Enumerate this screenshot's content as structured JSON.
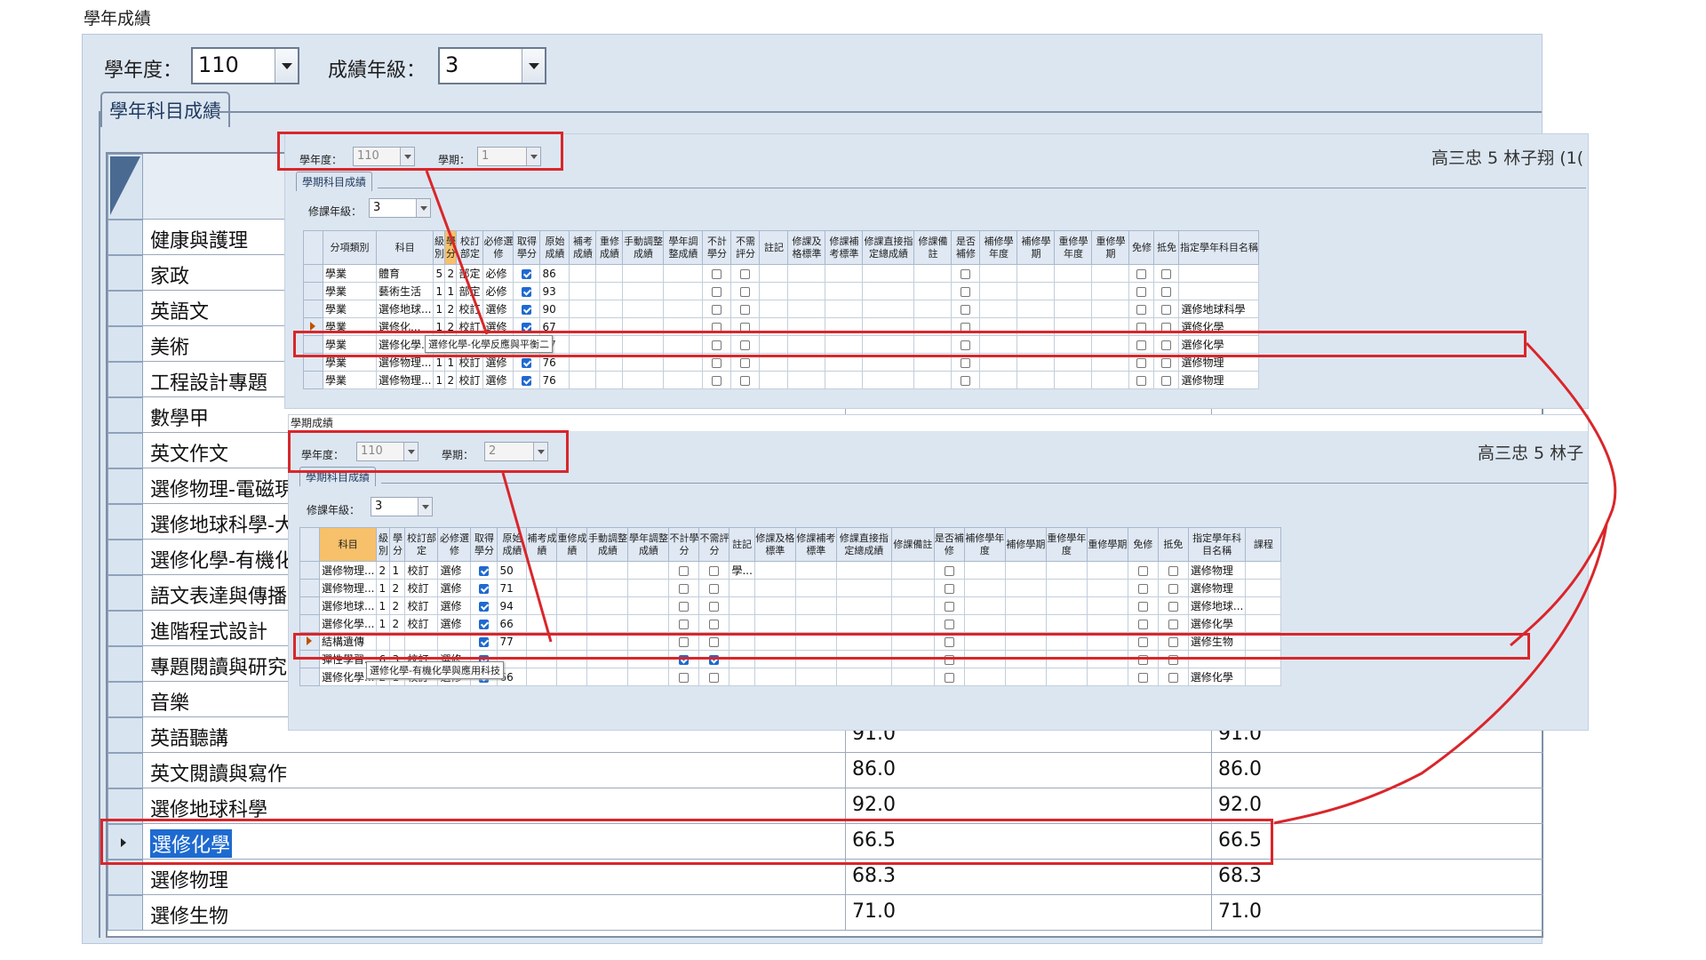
{
  "window_title": "學年成績",
  "filters": {
    "year_label": "學年度：",
    "year_value": "110",
    "grade_label": "成績年級：",
    "grade_value": "3"
  },
  "tab_label": "學年科目成績",
  "big_grid": {
    "rows": [
      {
        "subject": "健康與護理",
        "score1": "",
        "score2": ""
      },
      {
        "subject": "家政",
        "score1": "",
        "score2": ""
      },
      {
        "subject": "英語文",
        "score1": "",
        "score2": ""
      },
      {
        "subject": "美術",
        "score1": "",
        "score2": ""
      },
      {
        "subject": "工程設計專題",
        "score1": "",
        "score2": ""
      },
      {
        "subject": "數學甲",
        "score1": "",
        "score2": ""
      },
      {
        "subject": "英文作文",
        "score1": "",
        "score2": ""
      },
      {
        "subject": "選修物理-電磁現",
        "score1": "",
        "score2": ""
      },
      {
        "subject": "選修地球科學-大",
        "score1": "",
        "score2": ""
      },
      {
        "subject": "選修化學-有機化",
        "score1": "",
        "score2": ""
      },
      {
        "subject": "語文表達與傳播",
        "score1": "",
        "score2": ""
      },
      {
        "subject": "進階程式設計",
        "score1": "",
        "score2": ""
      },
      {
        "subject": "專題閱讀與研究",
        "score1": "",
        "score2": ""
      },
      {
        "subject": "音樂",
        "score1": "",
        "score2": ""
      },
      {
        "subject": "英語聽講",
        "score1": "91.0",
        "score2": "91.0"
      },
      {
        "subject": "英文閱讀與寫作",
        "score1": "86.0",
        "score2": "86.0"
      },
      {
        "subject": "選修地球科學",
        "score1": "92.0",
        "score2": "92.0"
      },
      {
        "subject": "選修化學",
        "score1": "66.5",
        "score2": "66.5",
        "selected": true
      },
      {
        "subject": "選修物理",
        "score1": "68.3",
        "score2": "68.3"
      },
      {
        "subject": "選修生物",
        "score1": "71.0",
        "score2": "71.0"
      }
    ]
  },
  "sem1": {
    "year_label": "學年度：",
    "year_value": "110",
    "sem_label": "學期：",
    "sem_value": "1",
    "student": "高三忠 5 林子翔 (1(",
    "tab_label": "學期科目成績",
    "grade_label": "修課年級：",
    "grade_value": "3",
    "headers": [
      "分項類別",
      "科目",
      "級別",
      "學分",
      "校訂部定",
      "必修選修",
      "取得學分",
      "原始成績",
      "補考成績",
      "重修成績",
      "手動調整成績",
      "學年調整成績",
      "不計學分",
      "不需評分",
      "註記",
      "修課及格標準",
      "修課補考標準",
      "修課直接指定總成績",
      "修課備註",
      "是否補修",
      "補修學年度",
      "補修學期",
      "重修學年度",
      "重修學期",
      "免修",
      "抵免",
      "指定學年科目名稱"
    ],
    "rows": [
      [
        "學業",
        "體育",
        "5",
        "2",
        "部定",
        "必修",
        true,
        "86",
        "",
        "",
        "",
        "",
        false,
        false,
        "",
        "",
        "",
        "",
        "",
        false,
        "",
        "",
        "",
        "",
        false,
        false,
        ""
      ],
      [
        "學業",
        "藝術生活",
        "1",
        "1",
        "部定",
        "必修",
        true,
        "93",
        "",
        "",
        "",
        "",
        false,
        false,
        "",
        "",
        "",
        "",
        "",
        false,
        "",
        "",
        "",
        "",
        false,
        false,
        ""
      ],
      [
        "學業",
        "選修地球...",
        "1",
        "2",
        "校訂",
        "選修",
        true,
        "90",
        "",
        "",
        "",
        "",
        false,
        false,
        "",
        "",
        "",
        "",
        "",
        false,
        "",
        "",
        "",
        "",
        false,
        false,
        "選修地球科學"
      ],
      [
        "學業",
        "選修化...",
        "1",
        "2",
        "校訂",
        "選修",
        true,
        "67",
        "",
        "",
        "",
        "",
        false,
        false,
        "",
        "",
        "",
        "",
        "",
        false,
        "",
        "",
        "",
        "",
        false,
        false,
        "選修化學"
      ],
      [
        "學業",
        "選修化學...",
        "1",
        "2",
        "校訂",
        "選修",
        true,
        "67",
        "",
        "",
        "",
        "",
        false,
        false,
        "",
        "",
        "",
        "",
        "",
        false,
        "",
        "",
        "",
        "",
        false,
        false,
        "選修化學"
      ],
      [
        "學業",
        "選修物理...",
        "1",
        "1",
        "校訂",
        "選修",
        true,
        "76",
        "",
        "",
        "",
        "",
        false,
        false,
        "",
        "",
        "",
        "",
        "",
        false,
        "",
        "",
        "",
        "",
        false,
        false,
        "選修物理"
      ],
      [
        "學業",
        "選修物理...",
        "1",
        "2",
        "校訂",
        "選修",
        true,
        "76",
        "",
        "",
        "",
        "",
        false,
        false,
        "",
        "",
        "",
        "",
        "",
        false,
        "",
        "",
        "",
        "",
        false,
        false,
        "選修物理"
      ]
    ],
    "tooltip": "選修化學-化學反應與平衡二"
  },
  "sem2": {
    "window_label": "學期成績",
    "year_label": "學年度：",
    "year_value": "110",
    "sem_label": "學期：",
    "sem_value": "2",
    "student": "高三忠 5 林子",
    "tab_label": "學期科目成績",
    "grade_label": "修課年級：",
    "grade_value": "3",
    "headers": [
      "科目",
      "級別",
      "學分",
      "校訂部定",
      "必修選修",
      "取得學分",
      "原始成績",
      "補考成績",
      "重修成績",
      "手動調整成績",
      "學年調整成績",
      "不計學分",
      "不需評分",
      "註記",
      "修課及格標準",
      "修課補考標準",
      "修課直接指定總成績",
      "修課備註",
      "是否補修",
      "補修學年度",
      "補修學期",
      "重修學年度",
      "重修學期",
      "免修",
      "抵免",
      "指定學年科目名稱",
      "課程"
    ],
    "rows": [
      [
        "選修物理...",
        "2",
        "1",
        "校訂",
        "選修",
        true,
        "50",
        "",
        "",
        "",
        "",
        false,
        false,
        "學...",
        "",
        "",
        "",
        "",
        false,
        "",
        "",
        "",
        "",
        false,
        false,
        "選修物理",
        ""
      ],
      [
        "選修物理...",
        "1",
        "2",
        "校訂",
        "選修",
        true,
        "71",
        "",
        "",
        "",
        "",
        false,
        false,
        "",
        "",
        "",
        "",
        "",
        false,
        "",
        "",
        "",
        "",
        false,
        false,
        "選修物理",
        ""
      ],
      [
        "選修地球...",
        "1",
        "2",
        "校訂",
        "選修",
        true,
        "94",
        "",
        "",
        "",
        "",
        false,
        false,
        "",
        "",
        "",
        "",
        "",
        false,
        "",
        "",
        "",
        "",
        false,
        false,
        "選修地球...",
        ""
      ],
      [
        "選修化學...",
        "1",
        "2",
        "校訂",
        "選修",
        true,
        "66",
        "",
        "",
        "",
        "",
        false,
        false,
        "",
        "",
        "",
        "",
        "",
        false,
        "",
        "",
        "",
        "",
        false,
        false,
        "選修化學",
        ""
      ],
      [
        "結構遺傳",
        "",
        "",
        "",
        "",
        true,
        "77",
        "",
        "",
        "",
        "",
        false,
        false,
        "",
        "",
        "",
        "",
        "",
        false,
        "",
        "",
        "",
        "",
        false,
        false,
        "選修生物",
        ""
      ],
      [
        "彈性學習...",
        "6",
        "3",
        "校訂",
        "選修",
        true,
        "",
        "",
        "",
        "",
        "",
        true,
        true,
        "",
        "",
        "",
        "",
        "",
        false,
        "",
        "",
        "",
        "",
        false,
        false,
        "",
        ""
      ],
      [
        "選修化學...",
        "2",
        "1",
        "校訂",
        "選修",
        true,
        "66",
        "",
        "",
        "",
        "",
        false,
        false,
        "",
        "",
        "",
        "",
        "",
        false,
        "",
        "",
        "",
        "",
        false,
        false,
        "選修化學",
        ""
      ]
    ],
    "tooltip": "選修化學-有機化學與應用科技"
  },
  "colors": {
    "highlight": "#d9262a",
    "selected_header": "#f7c06a",
    "check": "#1e6ad0"
  }
}
